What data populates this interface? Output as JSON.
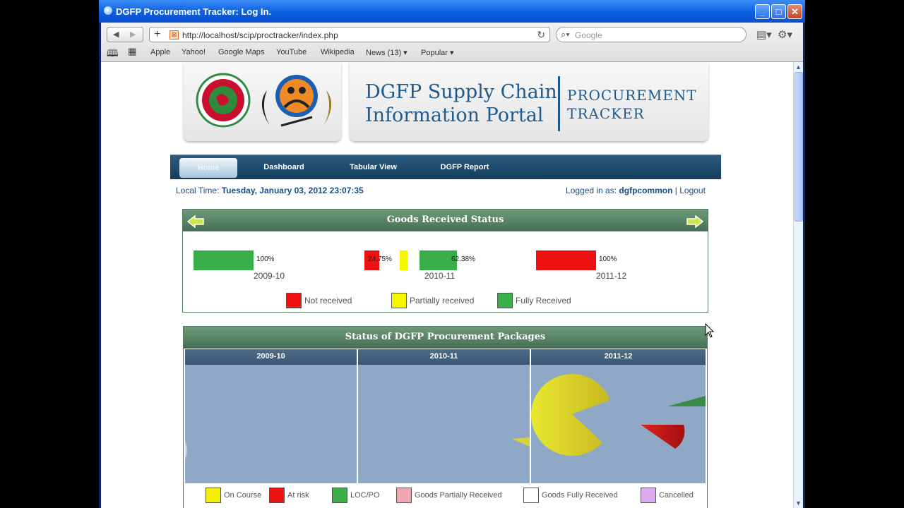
{
  "window": {
    "title": "DGFP Procurement Tracker: Log In.",
    "buttons": {
      "minimize": "_",
      "maximize": "□",
      "close": "✕"
    }
  },
  "browser": {
    "back": "◀",
    "forward": "▶",
    "add": "+",
    "url": "http://localhost/scip/proctracker/index.php",
    "search_placeholder": "Google",
    "bookmarks": [
      "Apple",
      "Yahoo!",
      "Google Maps",
      "YouTube",
      "Wikipedia",
      "News (13)",
      "Popular"
    ]
  },
  "header": {
    "portal_title_line1": "DGFP Supply Chain",
    "portal_title_line2": "Information Portal",
    "tracker_line1": "PROCUREMENT",
    "tracker_line2": "TRACKER"
  },
  "nav": {
    "items": [
      {
        "label": "Home",
        "active": true
      },
      {
        "label": "Dashboard",
        "active": false
      },
      {
        "label": "Tabular View",
        "active": false
      },
      {
        "label": "DGFP Report",
        "active": false
      }
    ]
  },
  "info": {
    "local_time_label": "Local Time:",
    "local_time_value": "Tuesday, January 03, 2012 23:07:35",
    "logged_in_label": "Logged in as:",
    "user": "dgfpcommon",
    "separator": "|",
    "logout": "Logout"
  },
  "goods_status": {
    "title": "Goods Received Status",
    "years": [
      {
        "label": "2009-10",
        "not_received": null,
        "partially": null,
        "fully": "100%"
      },
      {
        "label": "2010-11",
        "not_received": "24.75%",
        "partially": "",
        "fully": "62.38%"
      },
      {
        "label": "2011-12",
        "not_received": "100%",
        "partially": null,
        "fully": null
      }
    ],
    "values": {
      "2009-10": {
        "fully": 100
      },
      "2010-11": {
        "not_received": 24.75,
        "partially": 12.87,
        "fully": 62.38
      },
      "2011-12": {
        "not_received": 100
      }
    },
    "legend": [
      {
        "label": "Not received",
        "color": "#ee1111"
      },
      {
        "label": "Partially received",
        "color": "#f5f500"
      },
      {
        "label": "Fully Received",
        "color": "#3aae4a"
      }
    ]
  },
  "packages": {
    "title": "Status of DGFP Procurement Packages",
    "years": [
      "2009-10",
      "2010-11",
      "2011-12"
    ],
    "legend": [
      {
        "label": "On Course",
        "color": "#f5f000"
      },
      {
        "label": "At risk",
        "color": "#ee1111"
      },
      {
        "label": "LOC/PO",
        "color": "#3aae4a"
      },
      {
        "label": "Goods Partially Received",
        "color": "#f0a8b0"
      },
      {
        "label": "Goods Fully Received",
        "color": "#ffffff"
      },
      {
        "label": "Cancelled",
        "color": "#dcaaf0"
      }
    ]
  }
}
